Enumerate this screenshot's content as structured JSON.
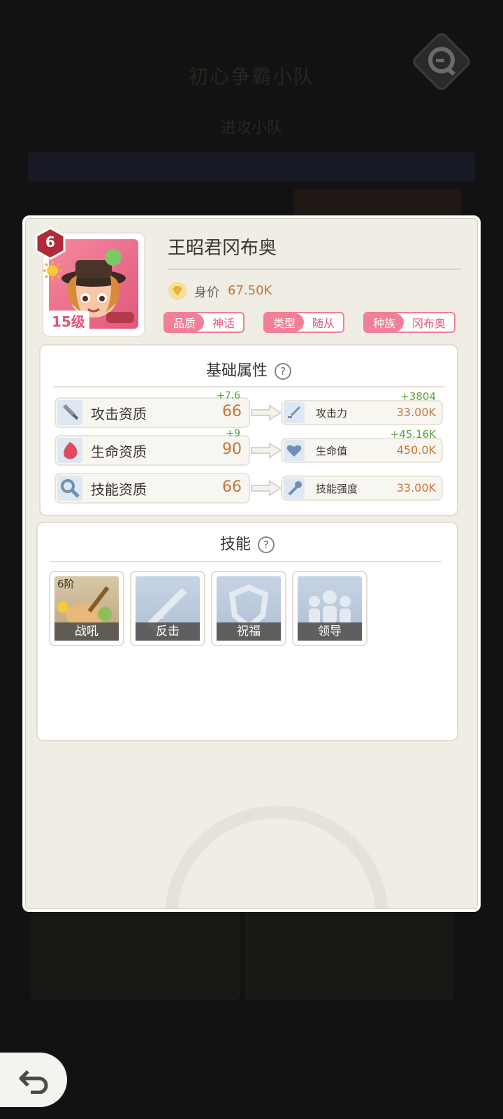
{
  "background": {
    "title": "初心争霸小队",
    "subtitle": "进攻小队"
  },
  "hero": {
    "level_badge": "6",
    "level_text": "15级",
    "name": "王昭君冈布奥",
    "price_label": "身价",
    "price_value": "67.50K",
    "tags": [
      {
        "key": "品质",
        "value": "神话"
      },
      {
        "key": "类型",
        "value": "随从"
      },
      {
        "key": "种族",
        "value": "冈布奥"
      }
    ]
  },
  "basic_attributes": {
    "title": "基础属性",
    "help": "?",
    "rows": [
      {
        "name": "攻击资质",
        "value": "66",
        "bonus": "+7.6",
        "stat_name": "攻击力",
        "stat_value": "33.00K",
        "stat_bonus": "+3804",
        "icon": "sword-icon",
        "stat_icon": "blade-icon"
      },
      {
        "name": "生命资质",
        "value": "90",
        "bonus": "+9",
        "stat_name": "生命值",
        "stat_value": "450.0K",
        "stat_bonus": "+45.16K",
        "icon": "drop-icon",
        "stat_icon": "heart-icon"
      },
      {
        "name": "技能资质",
        "value": "66",
        "bonus": "",
        "stat_name": "技能强度",
        "stat_value": "33.00K",
        "stat_bonus": "",
        "icon": "magnifier-icon",
        "stat_icon": "wand-icon"
      }
    ]
  },
  "skills": {
    "title": "技能",
    "help": "?",
    "items": [
      {
        "label": "战吼",
        "tier": "6阶",
        "icon": "lute-icon"
      },
      {
        "label": "反击",
        "tier": "",
        "icon": "crossed-swords-icon"
      },
      {
        "label": "祝福",
        "tier": "",
        "icon": "shield-icon"
      },
      {
        "label": "领导",
        "tier": "",
        "icon": "group-icon"
      }
    ]
  },
  "colors": {
    "accent_pink": "#f07f98",
    "value_orange": "#c8743a",
    "bonus_green": "#5aa43a"
  }
}
